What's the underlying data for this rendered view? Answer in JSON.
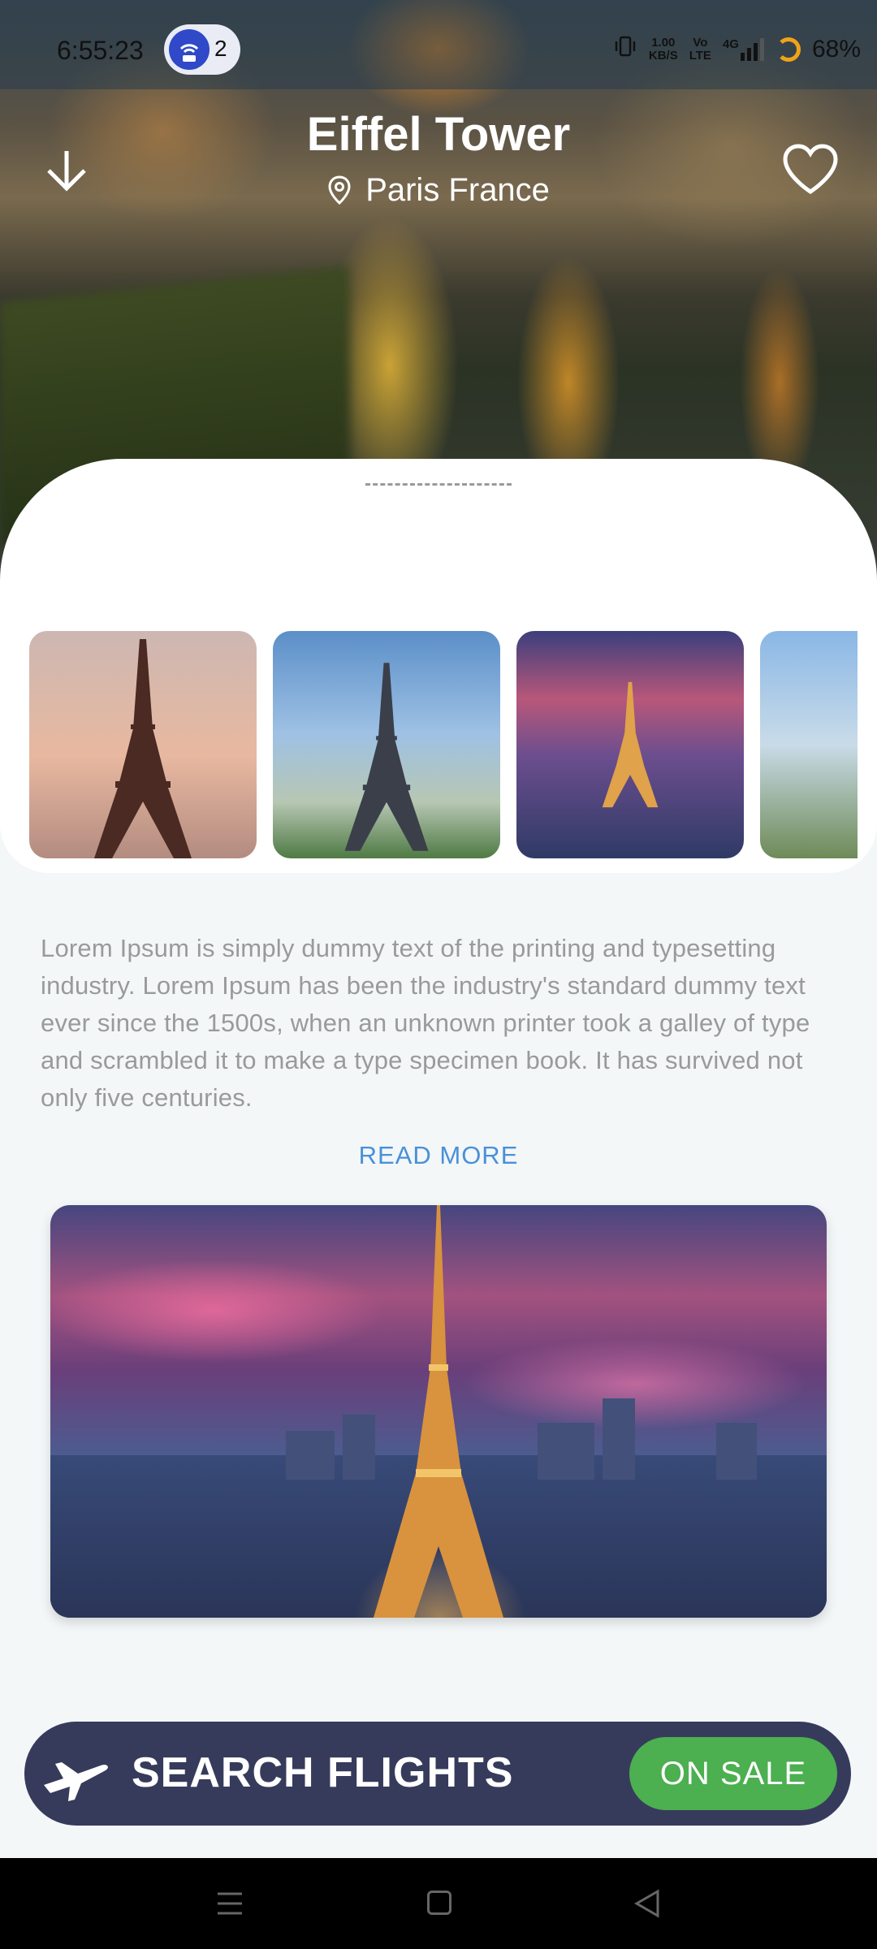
{
  "status_bar": {
    "time": "6:55:23",
    "notification_count": "2",
    "network_speed_value": "1.00",
    "network_speed_unit": "KB/S",
    "volte_top": "Vo",
    "volte_bottom": "LTE",
    "network_type": "4G",
    "battery": "68%"
  },
  "header": {
    "title": "Eiffel Tower",
    "location": "Paris France"
  },
  "gallery": {
    "images": [
      "eiffel-tower-sunset-photo",
      "eiffel-tower-daytime-photo",
      "eiffel-tower-dusk-city-photo",
      "eiffel-tower-side-photo"
    ]
  },
  "description": {
    "text": "Lorem Ipsum is simply dummy text of the printing and typesetting industry. Lorem Ipsum has been the industry's standard dummy text ever since the 1500s, when an unknown printer took a galley of type and scrambled it to make a type specimen book. It has survived not only five centuries.",
    "read_more": "READ MORE"
  },
  "featured_image": "eiffel-tower-night-skyline-photo",
  "flights_bar": {
    "label": "SEARCH FLIGHTS",
    "sale_label": "ON SALE"
  },
  "colors": {
    "accent_blue": "#4a90d9",
    "flights_bar_bg": "#363b5c",
    "sale_green": "#4caf50",
    "background": "#f3f7f8"
  },
  "icons": [
    "download-arrow-icon",
    "heart-icon",
    "location-pin-icon",
    "airplane-icon",
    "menu-nav-icon",
    "home-nav-icon",
    "back-nav-icon"
  ]
}
